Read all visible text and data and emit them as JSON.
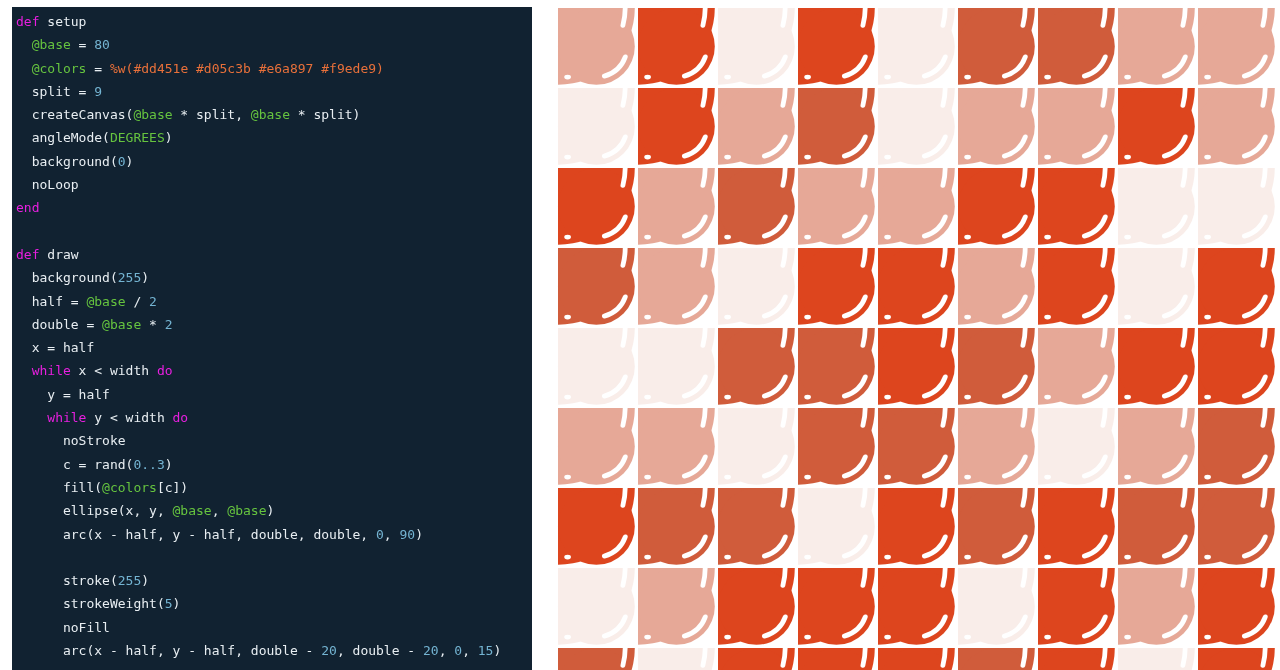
{
  "editor": {
    "lines": [
      {
        "kind": "code",
        "tokens": [
          {
            "kind": "keyword",
            "text": "def"
          },
          {
            "kind": "plain",
            "text": " setup"
          }
        ]
      },
      {
        "kind": "code",
        "tokens": [
          {
            "kind": "ivar",
            "text": "  @base"
          },
          {
            "kind": "plain",
            "text": " = "
          },
          {
            "kind": "number",
            "text": "80"
          }
        ]
      },
      {
        "kind": "code",
        "tokens": [
          {
            "kind": "ivar",
            "text": "  @colors"
          },
          {
            "kind": "plain",
            "text": " = "
          },
          {
            "kind": "string",
            "text": "%w(#dd451e #d05c3b #e6a897 #f9ede9)"
          }
        ]
      },
      {
        "kind": "code",
        "tokens": [
          {
            "kind": "plain",
            "text": "  split = "
          },
          {
            "kind": "number",
            "text": "9"
          }
        ]
      },
      {
        "kind": "code",
        "tokens": [
          {
            "kind": "plain",
            "text": "  createCanvas("
          },
          {
            "kind": "ivar",
            "text": "@base"
          },
          {
            "kind": "plain",
            "text": " * split, "
          },
          {
            "kind": "ivar",
            "text": "@base"
          },
          {
            "kind": "plain",
            "text": " * split)"
          }
        ]
      },
      {
        "kind": "code",
        "tokens": [
          {
            "kind": "plain",
            "text": "  angleMode("
          },
          {
            "kind": "constant",
            "text": "DEGREES"
          },
          {
            "kind": "plain",
            "text": ")"
          }
        ]
      },
      {
        "kind": "code",
        "tokens": [
          {
            "kind": "plain",
            "text": "  background("
          },
          {
            "kind": "number",
            "text": "0"
          },
          {
            "kind": "plain",
            "text": ")"
          }
        ]
      },
      {
        "kind": "code",
        "tokens": [
          {
            "kind": "plain",
            "text": "  noLoop"
          }
        ]
      },
      {
        "kind": "code",
        "tokens": [
          {
            "kind": "keyword",
            "text": "end"
          }
        ]
      },
      {
        "kind": "blank"
      },
      {
        "kind": "code",
        "tokens": [
          {
            "kind": "keyword",
            "text": "def"
          },
          {
            "kind": "plain",
            "text": " draw"
          }
        ]
      },
      {
        "kind": "code",
        "tokens": [
          {
            "kind": "plain",
            "text": "  background("
          },
          {
            "kind": "number",
            "text": "255"
          },
          {
            "kind": "plain",
            "text": ")"
          }
        ]
      },
      {
        "kind": "code",
        "tokens": [
          {
            "kind": "plain",
            "text": "  half = "
          },
          {
            "kind": "ivar",
            "text": "@base"
          },
          {
            "kind": "plain",
            "text": " / "
          },
          {
            "kind": "number",
            "text": "2"
          }
        ]
      },
      {
        "kind": "code",
        "tokens": [
          {
            "kind": "plain",
            "text": "  double = "
          },
          {
            "kind": "ivar",
            "text": "@base"
          },
          {
            "kind": "plain",
            "text": " * "
          },
          {
            "kind": "number",
            "text": "2"
          }
        ]
      },
      {
        "kind": "code",
        "tokens": [
          {
            "kind": "plain",
            "text": "  x = half"
          }
        ]
      },
      {
        "kind": "code",
        "tokens": [
          {
            "kind": "keyword",
            "text": "  while"
          },
          {
            "kind": "plain",
            "text": " x < width "
          },
          {
            "kind": "keyword",
            "text": "do"
          }
        ]
      },
      {
        "kind": "code",
        "tokens": [
          {
            "kind": "plain",
            "text": "    y = half"
          }
        ]
      },
      {
        "kind": "code",
        "tokens": [
          {
            "kind": "keyword",
            "text": "    while"
          },
          {
            "kind": "plain",
            "text": " y < width "
          },
          {
            "kind": "keyword",
            "text": "do"
          }
        ]
      },
      {
        "kind": "code",
        "tokens": [
          {
            "kind": "plain",
            "text": "      noStroke"
          }
        ]
      },
      {
        "kind": "code",
        "tokens": [
          {
            "kind": "plain",
            "text": "      c = rand("
          },
          {
            "kind": "number",
            "text": "0..3"
          },
          {
            "kind": "plain",
            "text": ")"
          }
        ]
      },
      {
        "kind": "code",
        "tokens": [
          {
            "kind": "plain",
            "text": "      fill("
          },
          {
            "kind": "ivar",
            "text": "@colors"
          },
          {
            "kind": "plain",
            "text": "[c])"
          }
        ]
      },
      {
        "kind": "code",
        "tokens": [
          {
            "kind": "plain",
            "text": "      ellipse(x, y, "
          },
          {
            "kind": "ivar",
            "text": "@base"
          },
          {
            "kind": "plain",
            "text": ", "
          },
          {
            "kind": "ivar",
            "text": "@base"
          },
          {
            "kind": "plain",
            "text": ")"
          }
        ]
      },
      {
        "kind": "code",
        "tokens": [
          {
            "kind": "plain",
            "text": "      arc(x - half, y - half, double, double, "
          },
          {
            "kind": "number",
            "text": "0"
          },
          {
            "kind": "plain",
            "text": ", "
          },
          {
            "kind": "number",
            "text": "90"
          },
          {
            "kind": "plain",
            "text": ")"
          }
        ]
      },
      {
        "kind": "blank"
      },
      {
        "kind": "code",
        "tokens": [
          {
            "kind": "plain",
            "text": "      stroke("
          },
          {
            "kind": "number",
            "text": "255"
          },
          {
            "kind": "plain",
            "text": ")"
          }
        ]
      },
      {
        "kind": "code",
        "tokens": [
          {
            "kind": "plain",
            "text": "      strokeWeight("
          },
          {
            "kind": "number",
            "text": "5"
          },
          {
            "kind": "plain",
            "text": ")"
          }
        ]
      },
      {
        "kind": "code",
        "tokens": [
          {
            "kind": "plain",
            "text": "      noFill"
          }
        ]
      },
      {
        "kind": "code",
        "tokens": [
          {
            "kind": "plain",
            "text": "      arc(x - half, y - half, double - "
          },
          {
            "kind": "number",
            "text": "20"
          },
          {
            "kind": "plain",
            "text": ", double - "
          },
          {
            "kind": "number",
            "text": "20"
          },
          {
            "kind": "plain",
            "text": ", "
          },
          {
            "kind": "number",
            "text": "0"
          },
          {
            "kind": "plain",
            "text": ", "
          },
          {
            "kind": "number",
            "text": "15"
          },
          {
            "kind": "plain",
            "text": ")"
          }
        ]
      }
    ]
  },
  "canvas": {
    "rows": [
      {
        "cells": [
          {
            "color": "#e6a897"
          },
          {
            "color": "#dd451e"
          },
          {
            "color": "#f9ede9"
          },
          {
            "color": "#dd451e"
          },
          {
            "color": "#f9ede9"
          },
          {
            "color": "#d05c3b"
          },
          {
            "color": "#d05c3b"
          },
          {
            "color": "#e6a897"
          },
          {
            "color": "#e6a897"
          }
        ]
      },
      {
        "cells": [
          {
            "color": "#f9ede9"
          },
          {
            "color": "#dd451e"
          },
          {
            "color": "#e6a897"
          },
          {
            "color": "#d05c3b"
          },
          {
            "color": "#f9ede9"
          },
          {
            "color": "#e6a897"
          },
          {
            "color": "#e6a897"
          },
          {
            "color": "#dd451e"
          },
          {
            "color": "#e6a897"
          }
        ]
      },
      {
        "cells": [
          {
            "color": "#dd451e"
          },
          {
            "color": "#e6a897"
          },
          {
            "color": "#d05c3b"
          },
          {
            "color": "#e6a897"
          },
          {
            "color": "#e6a897"
          },
          {
            "color": "#dd451e"
          },
          {
            "color": "#dd451e"
          },
          {
            "color": "#f9ede9"
          },
          {
            "color": "#f9ede9"
          }
        ]
      },
      {
        "cells": [
          {
            "color": "#d05c3b"
          },
          {
            "color": "#e6a897"
          },
          {
            "color": "#f9ede9"
          },
          {
            "color": "#dd451e"
          },
          {
            "color": "#dd451e"
          },
          {
            "color": "#e6a897"
          },
          {
            "color": "#dd451e"
          },
          {
            "color": "#f9ede9"
          },
          {
            "color": "#dd451e"
          }
        ]
      },
      {
        "cells": [
          {
            "color": "#f9ede9"
          },
          {
            "color": "#f9ede9"
          },
          {
            "color": "#d05c3b"
          },
          {
            "color": "#d05c3b"
          },
          {
            "color": "#dd451e"
          },
          {
            "color": "#d05c3b"
          },
          {
            "color": "#e6a897"
          },
          {
            "color": "#dd451e"
          },
          {
            "color": "#dd451e"
          }
        ]
      },
      {
        "cells": [
          {
            "color": "#e6a897"
          },
          {
            "color": "#e6a897"
          },
          {
            "color": "#f9ede9"
          },
          {
            "color": "#d05c3b"
          },
          {
            "color": "#d05c3b"
          },
          {
            "color": "#e6a897"
          },
          {
            "color": "#f9ede9"
          },
          {
            "color": "#e6a897"
          },
          {
            "color": "#d05c3b"
          }
        ]
      },
      {
        "cells": [
          {
            "color": "#dd451e"
          },
          {
            "color": "#d05c3b"
          },
          {
            "color": "#d05c3b"
          },
          {
            "color": "#f9ede9"
          },
          {
            "color": "#dd451e"
          },
          {
            "color": "#d05c3b"
          },
          {
            "color": "#dd451e"
          },
          {
            "color": "#d05c3b"
          },
          {
            "color": "#d05c3b"
          }
        ]
      },
      {
        "cells": [
          {
            "color": "#f9ede9"
          },
          {
            "color": "#e6a897"
          },
          {
            "color": "#dd451e"
          },
          {
            "color": "#dd451e"
          },
          {
            "color": "#dd451e"
          },
          {
            "color": "#f9ede9"
          },
          {
            "color": "#dd451e"
          },
          {
            "color": "#e6a897"
          },
          {
            "color": "#dd451e"
          }
        ]
      },
      {
        "cells": [
          {
            "color": "#d05c3b"
          },
          {
            "color": "#f9ede9"
          },
          {
            "color": "#dd451e"
          },
          {
            "color": "#dd451e"
          },
          {
            "color": "#dd451e"
          },
          {
            "color": "#d05c3b"
          },
          {
            "color": "#dd451e"
          },
          {
            "color": "#f9ede9"
          },
          {
            "color": "#dd451e"
          }
        ]
      }
    ]
  }
}
